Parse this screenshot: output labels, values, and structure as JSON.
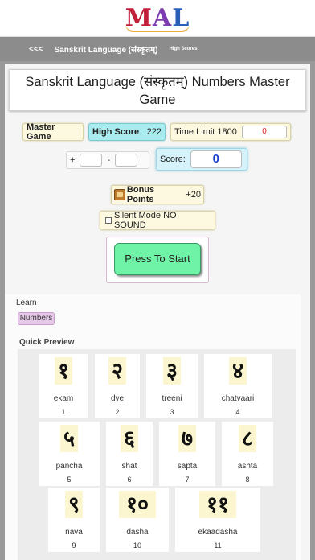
{
  "logo": {
    "letters": [
      "M",
      "A",
      "L"
    ]
  },
  "nav": {
    "back": "<<<",
    "title": "Sanskrit Language (संस्कृतम्)",
    "high_scores": "High Scores"
  },
  "game": {
    "title": "Sanskrit Language (संस्कृतम्) Numbers Master Game",
    "master_game": "Master Game",
    "high_score_label": "High Score",
    "high_score_value": "222",
    "time_limit_label": "Time Limit 1800",
    "time_value": "0",
    "plus": "+",
    "minus": "-",
    "score_label": "Score:",
    "score_value": "0",
    "bonus_label": "Bonus Points",
    "bonus_value": "+20",
    "silent_mode": "Silent Mode NO SOUND",
    "start_button": "Press To Start"
  },
  "learn": {
    "label": "Learn",
    "numbers_link": "Numbers"
  },
  "preview": {
    "label": "Quick Preview",
    "cards": [
      {
        "glyph": "१",
        "word": "ekam",
        "num": "1"
      },
      {
        "glyph": "२",
        "word": "dve",
        "num": "2"
      },
      {
        "glyph": "३",
        "word": "treeni",
        "num": "3"
      },
      {
        "glyph": "४",
        "word": "chatvaari",
        "num": "4"
      },
      {
        "glyph": "५",
        "word": "pancha",
        "num": "5"
      },
      {
        "glyph": "६",
        "word": "shat",
        "num": "6"
      },
      {
        "glyph": "७",
        "word": "sapta",
        "num": "7"
      },
      {
        "glyph": "८",
        "word": "ashta",
        "num": "8"
      },
      {
        "glyph": "९",
        "word": "nava",
        "num": "9"
      },
      {
        "glyph": "१०",
        "word": "dasha",
        "num": "10"
      },
      {
        "glyph": "११",
        "word": "ekaadasha",
        "num": "11"
      }
    ]
  },
  "colors": {
    "logo_m": "#c0203a",
    "logo_a": "#7b3db0",
    "logo_l": "#2a5fb8",
    "nav_bar": "#8c8c8c",
    "high_score_chip": "#a9ecf0",
    "start_button": "#6ff3a6",
    "score_value": "#1c3fd0",
    "time_value": "#e02020",
    "numbers_link": "#e5c8e8"
  }
}
